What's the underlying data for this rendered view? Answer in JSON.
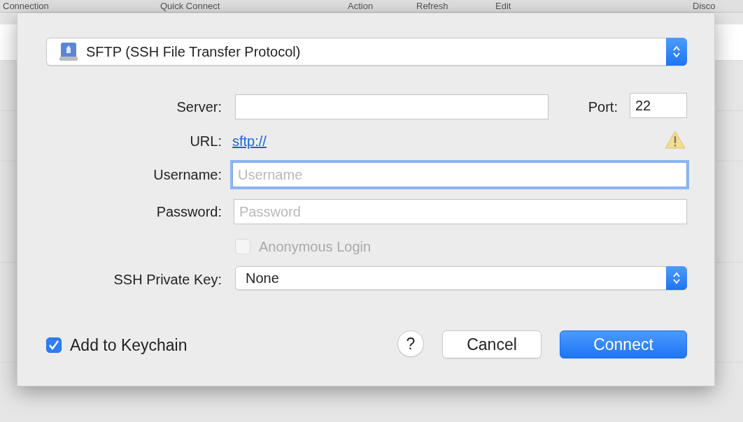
{
  "toolbar": [
    {
      "label": "Connection"
    },
    {
      "label": "Quick Connect"
    },
    {
      "label": "Action"
    },
    {
      "label": "Refresh"
    },
    {
      "label": "Edit"
    },
    {
      "label": "Disco"
    }
  ],
  "protocol": {
    "value": "SFTP (SSH File Transfer Protocol)"
  },
  "server": {
    "label": "Server:"
  },
  "port": {
    "label": "Port:",
    "value": "22"
  },
  "url": {
    "label": "URL:",
    "link": "sftp://"
  },
  "username": {
    "label": "Username:",
    "placeholder": "Username",
    "focused": true
  },
  "password": {
    "label": "Password:",
    "placeholder": "Password",
    "focused": false
  },
  "anonymous_login": {
    "label": "Anonymous Login",
    "checked": false,
    "disabled": true
  },
  "ssh_private_key": {
    "label": "SSH Private Key:",
    "value": "None"
  },
  "add_to_keychain": {
    "label": "Add to Keychain",
    "checked": true,
    "disabled": false
  },
  "buttons": [
    {
      "kind": "help",
      "label": "?"
    },
    {
      "kind": "cancel",
      "label": "Cancel"
    },
    {
      "kind": "default",
      "label": "Connect"
    }
  ]
}
